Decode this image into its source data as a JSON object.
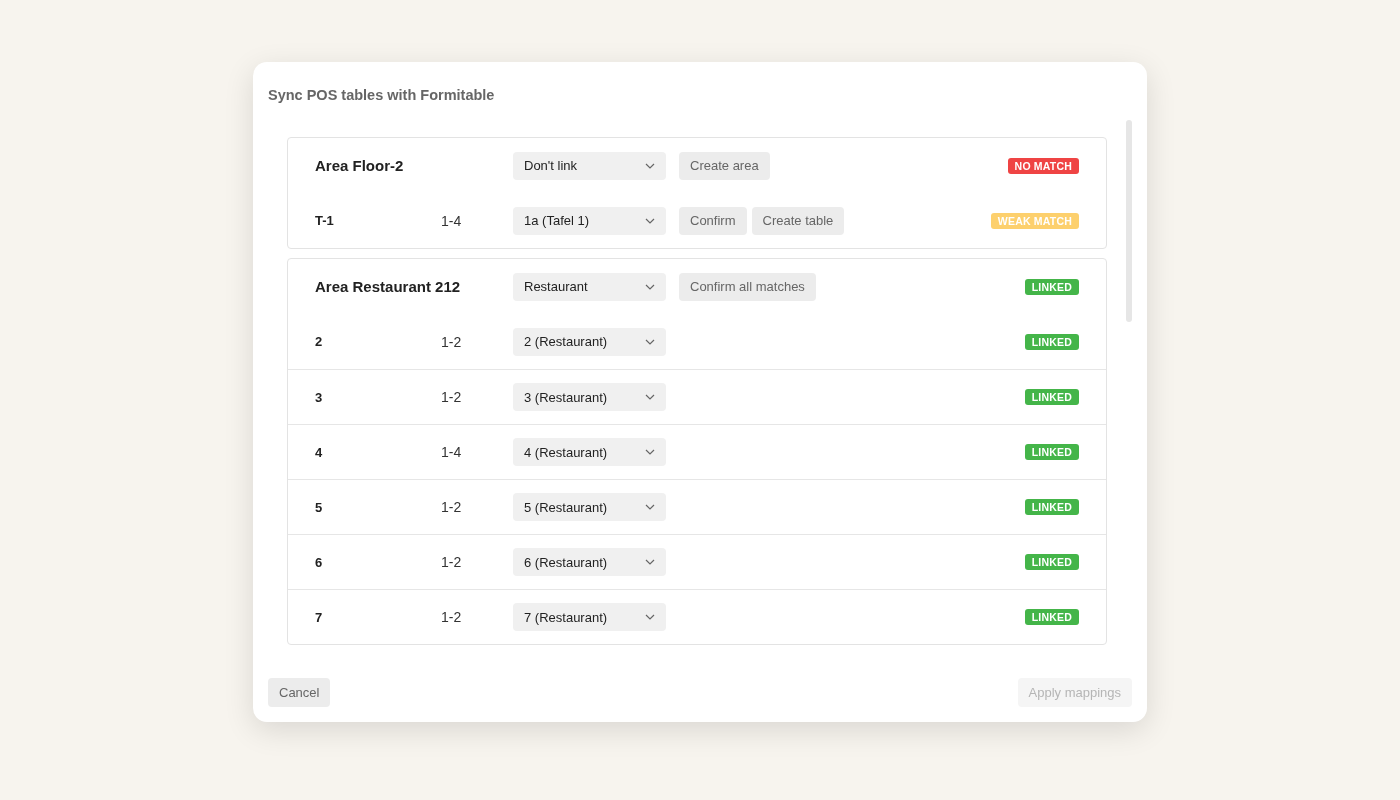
{
  "dialog": {
    "title": "Sync POS tables with Formitable"
  },
  "areas": [
    {
      "name": "Area Floor-2",
      "mapping": "Don't link",
      "actions": [
        "Create area"
      ],
      "status": {
        "label": "NO MATCH",
        "color": "#ef4444"
      },
      "tables": [
        {
          "name": "T-1",
          "capacity": "1-4",
          "mapping": "1a (Tafel 1)",
          "actions": [
            "Confirm",
            "Create table"
          ],
          "status": {
            "label": "WEAK MATCH",
            "color": "#fdd06d"
          }
        }
      ]
    },
    {
      "name": "Area Restaurant 212",
      "mapping": "Restaurant",
      "actions": [
        "Confirm all matches"
      ],
      "status": {
        "label": "LINKED",
        "color": "#44b549"
      },
      "tables": [
        {
          "name": "2",
          "capacity": "1-2",
          "mapping": "2 (Restaurant)",
          "status": {
            "label": "LINKED",
            "color": "#44b549"
          }
        },
        {
          "name": "3",
          "capacity": "1-2",
          "mapping": "3 (Restaurant)",
          "status": {
            "label": "LINKED",
            "color": "#44b549"
          }
        },
        {
          "name": "4",
          "capacity": "1-4",
          "mapping": "4 (Restaurant)",
          "status": {
            "label": "LINKED",
            "color": "#44b549"
          }
        },
        {
          "name": "5",
          "capacity": "1-2",
          "mapping": "5 (Restaurant)",
          "status": {
            "label": "LINKED",
            "color": "#44b549"
          }
        },
        {
          "name": "6",
          "capacity": "1-2",
          "mapping": "6 (Restaurant)",
          "status": {
            "label": "LINKED",
            "color": "#44b549"
          }
        },
        {
          "name": "7",
          "capacity": "1-2",
          "mapping": "7 (Restaurant)",
          "status": {
            "label": "LINKED",
            "color": "#44b549"
          }
        }
      ]
    }
  ],
  "footer": {
    "buttons": [
      {
        "label": "Cancel",
        "disabled": false
      },
      {
        "label": "Apply mappings",
        "disabled": true
      }
    ]
  }
}
